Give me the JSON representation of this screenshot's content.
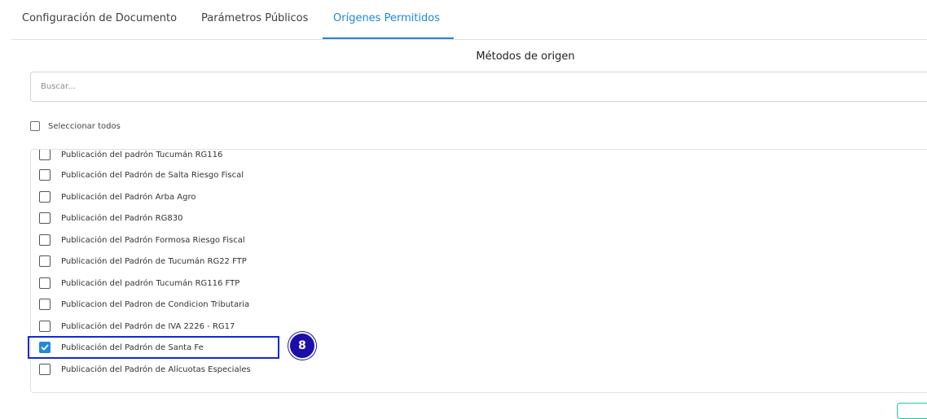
{
  "tabs": [
    {
      "label": "Configuración de Documento"
    },
    {
      "label": "Parámetros Públicos"
    },
    {
      "label": "Orígenes Permitidos"
    }
  ],
  "active_tab": "Orígenes Permitidos",
  "section_title": "Métodos de origen",
  "search": {
    "placeholder": "Buscar...",
    "value": ""
  },
  "select_all": {
    "label": "Seleccionar todos",
    "checked": false
  },
  "items": [
    {
      "label": "Publicación del padrón Tucumán RG116",
      "checked": false
    },
    {
      "label": "Publicación del Padrón de Salta Riesgo Fiscal",
      "checked": false
    },
    {
      "label": "Publicación del Padrón Arba Agro",
      "checked": false
    },
    {
      "label": "Publicación del Padrón RG830",
      "checked": false
    },
    {
      "label": "Publicación del Padrón Formosa Riesgo Fiscal",
      "checked": false
    },
    {
      "label": "Publicación del Padrón de Tucumán RG22 FTP",
      "checked": false
    },
    {
      "label": "Publicación del padrón Tucumán RG116 FTP",
      "checked": false
    },
    {
      "label": "Publicacion del Padron de Condicion Tributaria",
      "checked": false
    },
    {
      "label": "Publicación del Padrón de IVA 2226 - RG17",
      "checked": false
    },
    {
      "label": "Publicación del Padrón de Santa Fe",
      "checked": true
    },
    {
      "label": "Publicación del Padrón de Alícuotas Especiales",
      "checked": false
    }
  ],
  "step_badge": "8",
  "colors": {
    "accent": "#1e88d3",
    "highlight": "#1228d8",
    "badge": "#1a0fa8",
    "button_border": "#20c997"
  }
}
